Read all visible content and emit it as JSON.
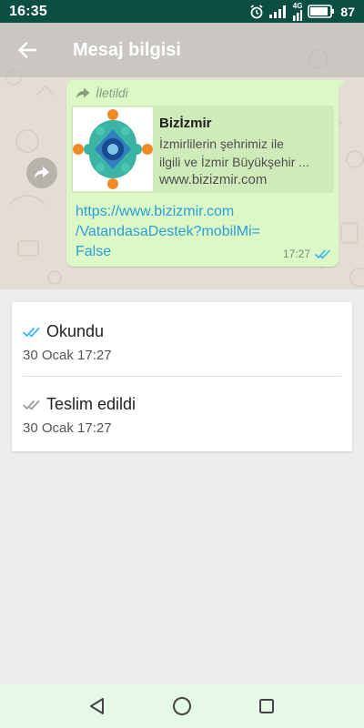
{
  "status_bar": {
    "time": "16:35",
    "network": "4G",
    "battery": "87"
  },
  "header": {
    "title": "Mesaj bilgisi"
  },
  "message": {
    "forwarded_label": "İletildi",
    "preview": {
      "title": "Bizİzmir",
      "description_line1": "İzmirlilerin şehrimiz ile",
      "description_line2": "ilgili ve İzmir Büyükşehir ...",
      "url": "www.bizizmir.com"
    },
    "link_lines": [
      "https://www.bizizmir.com",
      "/VatandasaDestek?mobilMi=",
      "False"
    ],
    "time": "17:27",
    "read_tick_color": "#34b7f1"
  },
  "info": {
    "read": {
      "label": "Okundu",
      "time": "30 Ocak 17:27"
    },
    "delivered": {
      "label": "Teslim edildi",
      "time": "30 Ocak 17:27"
    }
  },
  "colors": {
    "status_bar": "#0b4f44",
    "bubble": "#dcf8c6",
    "link": "#2a9fd6",
    "nav_bar": "#e6f9e8"
  }
}
